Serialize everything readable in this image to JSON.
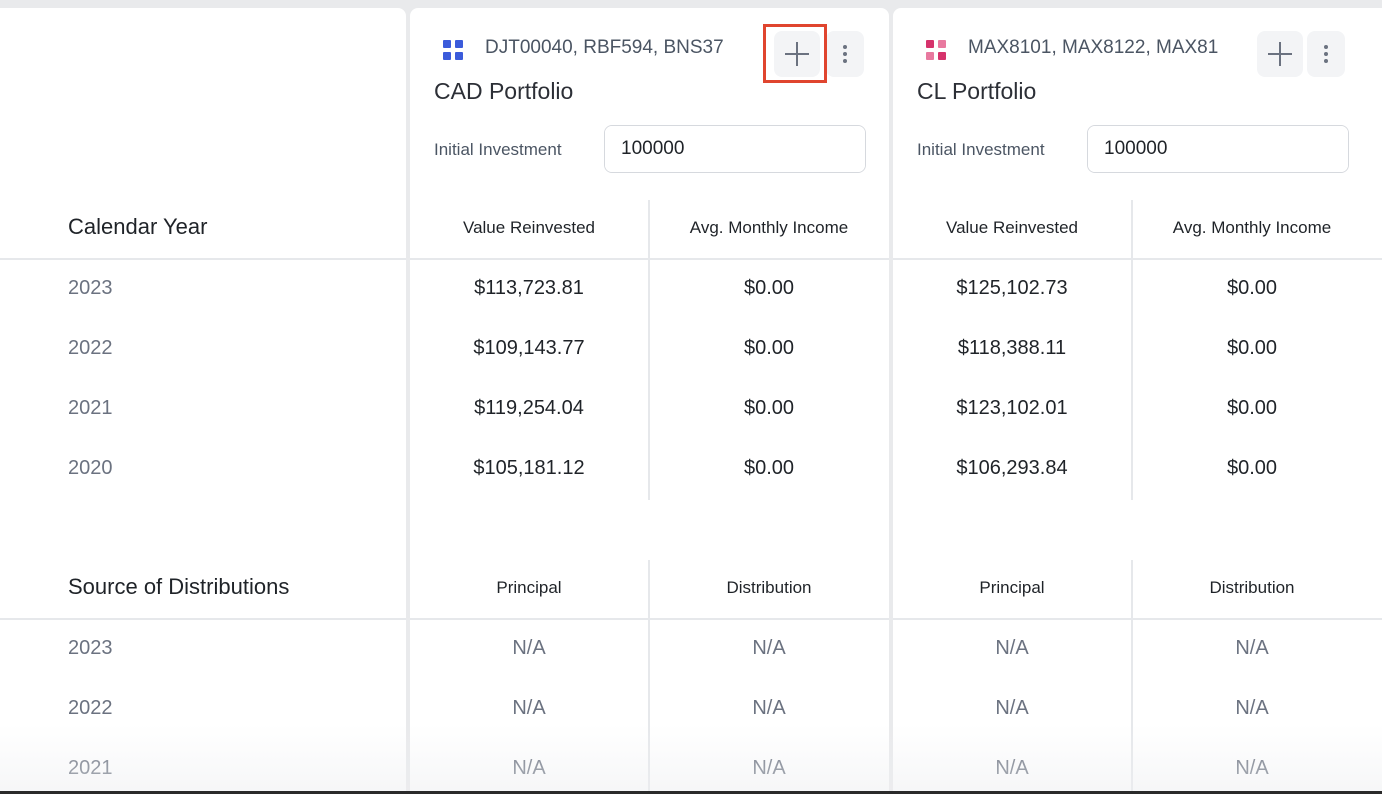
{
  "left": {
    "calendar_title": "Calendar Year",
    "calendar_years": [
      "2023",
      "2022",
      "2021",
      "2020"
    ],
    "sources_title": "Source of Distributions",
    "source_years": [
      "2023",
      "2022",
      "2021"
    ]
  },
  "portfolios": [
    {
      "tickers": "DJT00040, RBF594, BNS37",
      "name": "CAD Portfolio",
      "icon_color": "#3b5bdb",
      "investment_label": "Initial Investment",
      "investment_value": "100000",
      "currency": "$",
      "col_headers": [
        "Value Reinvested",
        "Avg. Monthly Income"
      ],
      "calendar_rows": [
        [
          "$113,723.81",
          "$0.00"
        ],
        [
          "$109,143.77",
          "$0.00"
        ],
        [
          "$119,254.04",
          "$0.00"
        ],
        [
          "$105,181.12",
          "$0.00"
        ]
      ],
      "source_headers": [
        "Principal",
        "Distribution"
      ],
      "source_rows": [
        [
          "N/A",
          "N/A"
        ],
        [
          "N/A",
          "N/A"
        ],
        [
          "N/A",
          "N/A"
        ]
      ]
    },
    {
      "tickers": "MAX8101, MAX8122, MAX81",
      "name": "CL Portfolio",
      "icon_color": "#d6336c",
      "investment_label": "Initial Investment",
      "investment_value": "100000",
      "currency": "$",
      "col_headers": [
        "Value Reinvested",
        "Avg. Monthly Income"
      ],
      "calendar_rows": [
        [
          "$125,102.73",
          "$0.00"
        ],
        [
          "$118,388.11",
          "$0.00"
        ],
        [
          "$123,102.01",
          "$0.00"
        ],
        [
          "$106,293.84",
          "$0.00"
        ]
      ],
      "source_headers": [
        "Principal",
        "Distribution"
      ],
      "source_rows": [
        [
          "N/A",
          "N/A"
        ],
        [
          "N/A",
          "N/A"
        ],
        [
          "N/A",
          "N/A"
        ]
      ]
    }
  ]
}
